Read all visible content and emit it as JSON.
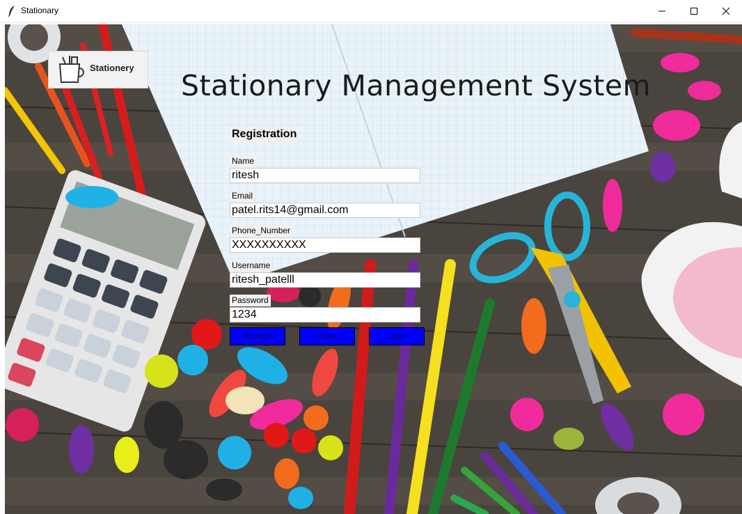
{
  "window": {
    "title": "Stationary"
  },
  "logo": {
    "text": "Stationery"
  },
  "heading": "Stationary Management System",
  "form": {
    "section_title": "Registration",
    "fields": [
      {
        "label": "Name",
        "value": "ritesh"
      },
      {
        "label": "Email",
        "value": "patel.rits14@gmail.com"
      },
      {
        "label": "Phone_Number",
        "value": "XXXXXXXXXX"
      },
      {
        "label": "Username",
        "value": "ritesh_patelll"
      },
      {
        "label": "Password",
        "value": "1234"
      }
    ],
    "buttons": {
      "register": "Register",
      "reset": "Reset",
      "login": "Login"
    }
  },
  "colors": {
    "button_bg": "#0000ff",
    "label_bg": "#f0f0f0",
    "desk": "#4d4741"
  },
  "icons": [
    "feather-icon",
    "minimize-icon",
    "maximize-icon",
    "close-icon",
    "stationery-cup-icon"
  ]
}
